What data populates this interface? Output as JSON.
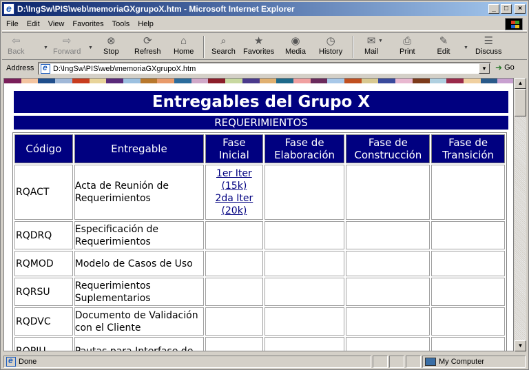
{
  "window": {
    "title": "D:\\IngSw\\PIS\\web\\memoriaGXgrupoX.htm - Microsoft Internet Explorer",
    "min_label": "_",
    "max_label": "□",
    "close_label": "×"
  },
  "menu": [
    "File",
    "Edit",
    "View",
    "Favorites",
    "Tools",
    "Help"
  ],
  "toolbar": {
    "back": "Back",
    "forward": "Forward",
    "stop": "Stop",
    "refresh": "Refresh",
    "home": "Home",
    "search": "Search",
    "favorites": "Favorites",
    "media": "Media",
    "history": "History",
    "mail": "Mail",
    "print": "Print",
    "edit": "Edit",
    "discuss": "Discuss"
  },
  "address": {
    "label": "Address",
    "url": "D:\\IngSw\\PIS\\web\\memoriaGXgrupoX.htm",
    "go_label": "Go"
  },
  "page": {
    "title": "Entregables del Grupo X",
    "section": "REQUERIMIENTOS",
    "headers": {
      "codigo": "Código",
      "entregable": "Entregable",
      "fase_inicial": "Fase Inicial",
      "fase_elaboracion": "Fase de Elaboración",
      "fase_construccion": "Fase de Construcción",
      "fase_transicion": "Fase de Transición"
    },
    "rows": [
      {
        "code": "RQACT",
        "name": "Acta de Reunión de Requerimientos",
        "link1": "1er Iter (15k)",
        "link2": "2da Iter (20k)"
      },
      {
        "code": "RQDRQ",
        "name": "Especificación de Requerimientos"
      },
      {
        "code": "RQMOD",
        "name": "Modelo de Casos de Uso"
      },
      {
        "code": "RQRSU",
        "name": "Requerimientos Suplementarios"
      },
      {
        "code": "RQDVC",
        "name": "Documento de Validación con el Cliente"
      },
      {
        "code": "RQPIU",
        "name": "Pautas para Interfase de"
      }
    ]
  },
  "status": {
    "text": "Done",
    "zone": "My Computer"
  },
  "colors": {
    "header_bg": "#000080",
    "link": "#000080",
    "chrome": "#d4d0c8"
  }
}
